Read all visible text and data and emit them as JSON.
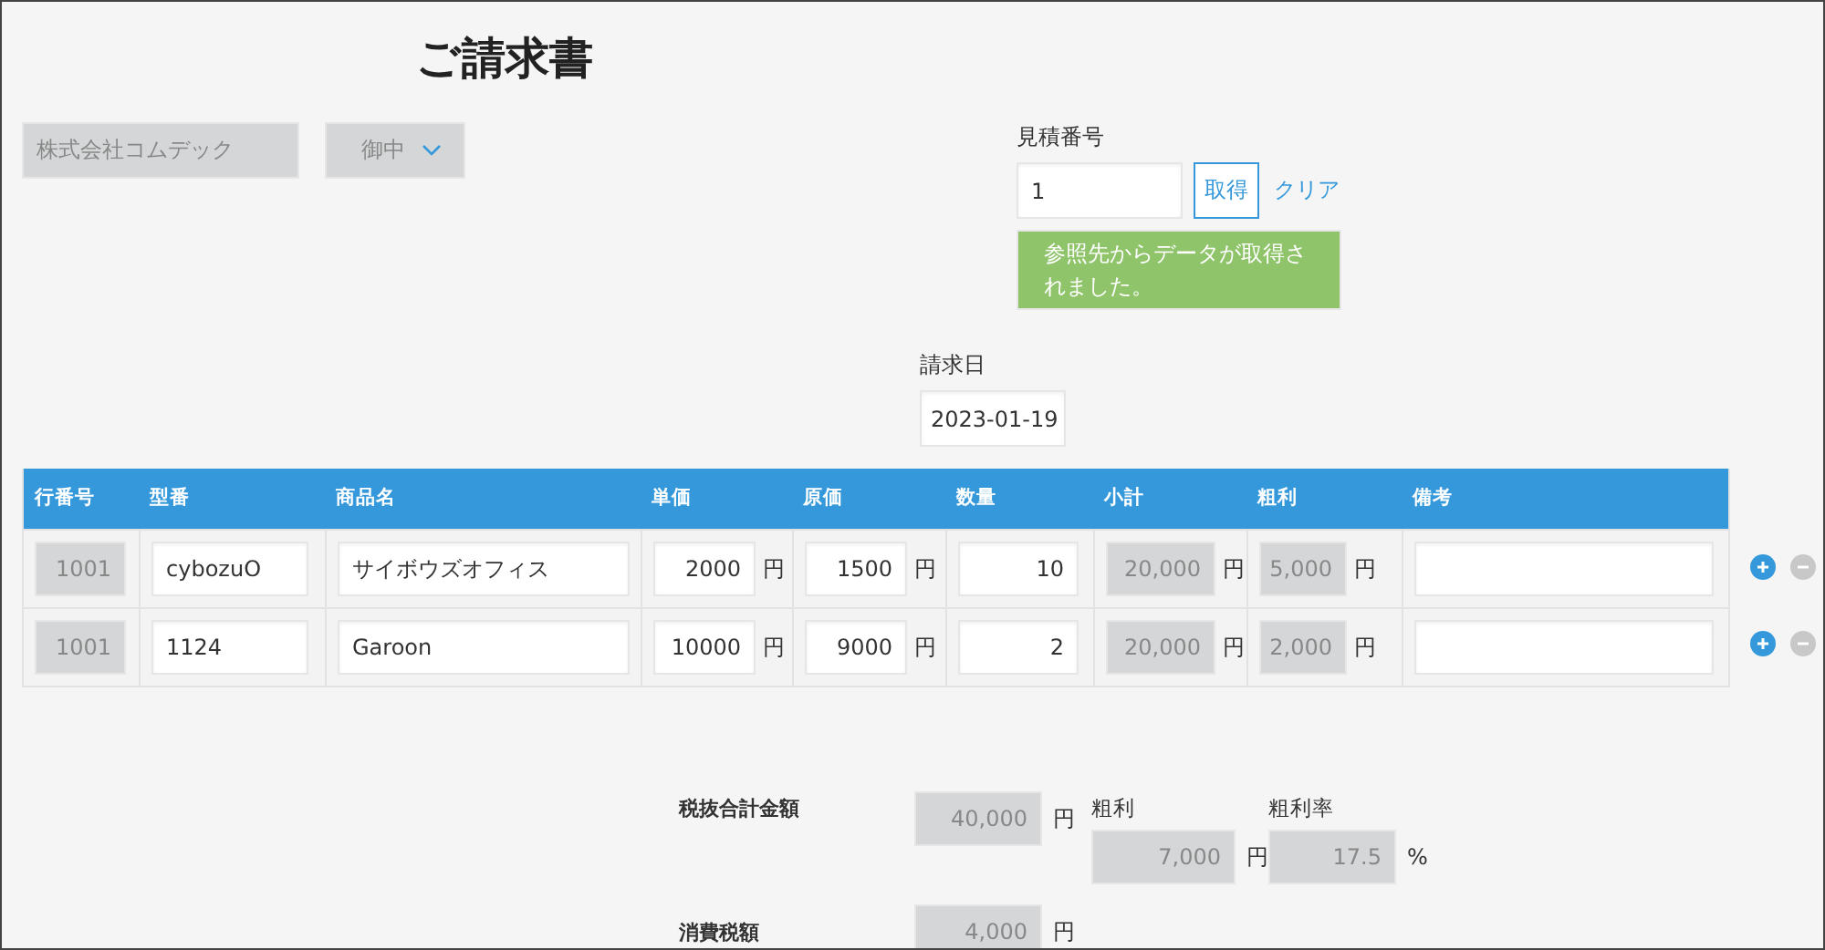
{
  "title": "ご請求書",
  "customer": {
    "company": "株式会社コムデック",
    "honorific": "御中"
  },
  "estimate": {
    "label": "見積番号",
    "value": "1",
    "fetch_button": "取得",
    "clear_link": "クリア",
    "message": "参照先からデータが取得されました。"
  },
  "invoice_date": {
    "label": "請求日",
    "value": "2023-01-19"
  },
  "table": {
    "columns": [
      {
        "label": "行番号",
        "kind": "readonly"
      },
      {
        "label": "型番",
        "kind": "text"
      },
      {
        "label": "商品名",
        "kind": "text"
      },
      {
        "label": "単価",
        "kind": "number"
      },
      {
        "label": "原価",
        "kind": "number"
      },
      {
        "label": "数量",
        "kind": "number"
      },
      {
        "label": "小計",
        "kind": "readonly"
      },
      {
        "label": "粗利",
        "kind": "readonly"
      },
      {
        "label": "備考",
        "kind": "text"
      }
    ],
    "rows": [
      {
        "cells": [
          {
            "value": "1001"
          },
          {
            "value": "cybozuO"
          },
          {
            "value": "サイボウズオフィス"
          },
          {
            "value": "2000",
            "unit": "円"
          },
          {
            "value": "1500",
            "unit": "円"
          },
          {
            "value": "10"
          },
          {
            "value": "20,000",
            "unit": "円"
          },
          {
            "value": "5,000",
            "unit": "円"
          },
          {}
        ]
      },
      {
        "cells": [
          {
            "value": "1001"
          },
          {
            "value": "1124"
          },
          {
            "value": "Garoon"
          },
          {
            "value": "10000",
            "unit": "円"
          },
          {
            "value": "9000",
            "unit": "円"
          },
          {
            "value": "2"
          },
          {
            "value": "20,000",
            "unit": "円"
          },
          {
            "value": "2,000",
            "unit": "円"
          },
          {}
        ]
      }
    ]
  },
  "summary": {
    "subtotal": {
      "label": "税抜合計金額",
      "value": "40,000",
      "unit": "円"
    },
    "gross_profit": {
      "label": "粗利",
      "value": "7,000",
      "unit": "円"
    },
    "profit_rate": {
      "label": "粗利率",
      "value": "17.5",
      "unit": "%"
    },
    "tax": {
      "label": "消費税額",
      "value": "4,000",
      "unit": "円"
    }
  }
}
